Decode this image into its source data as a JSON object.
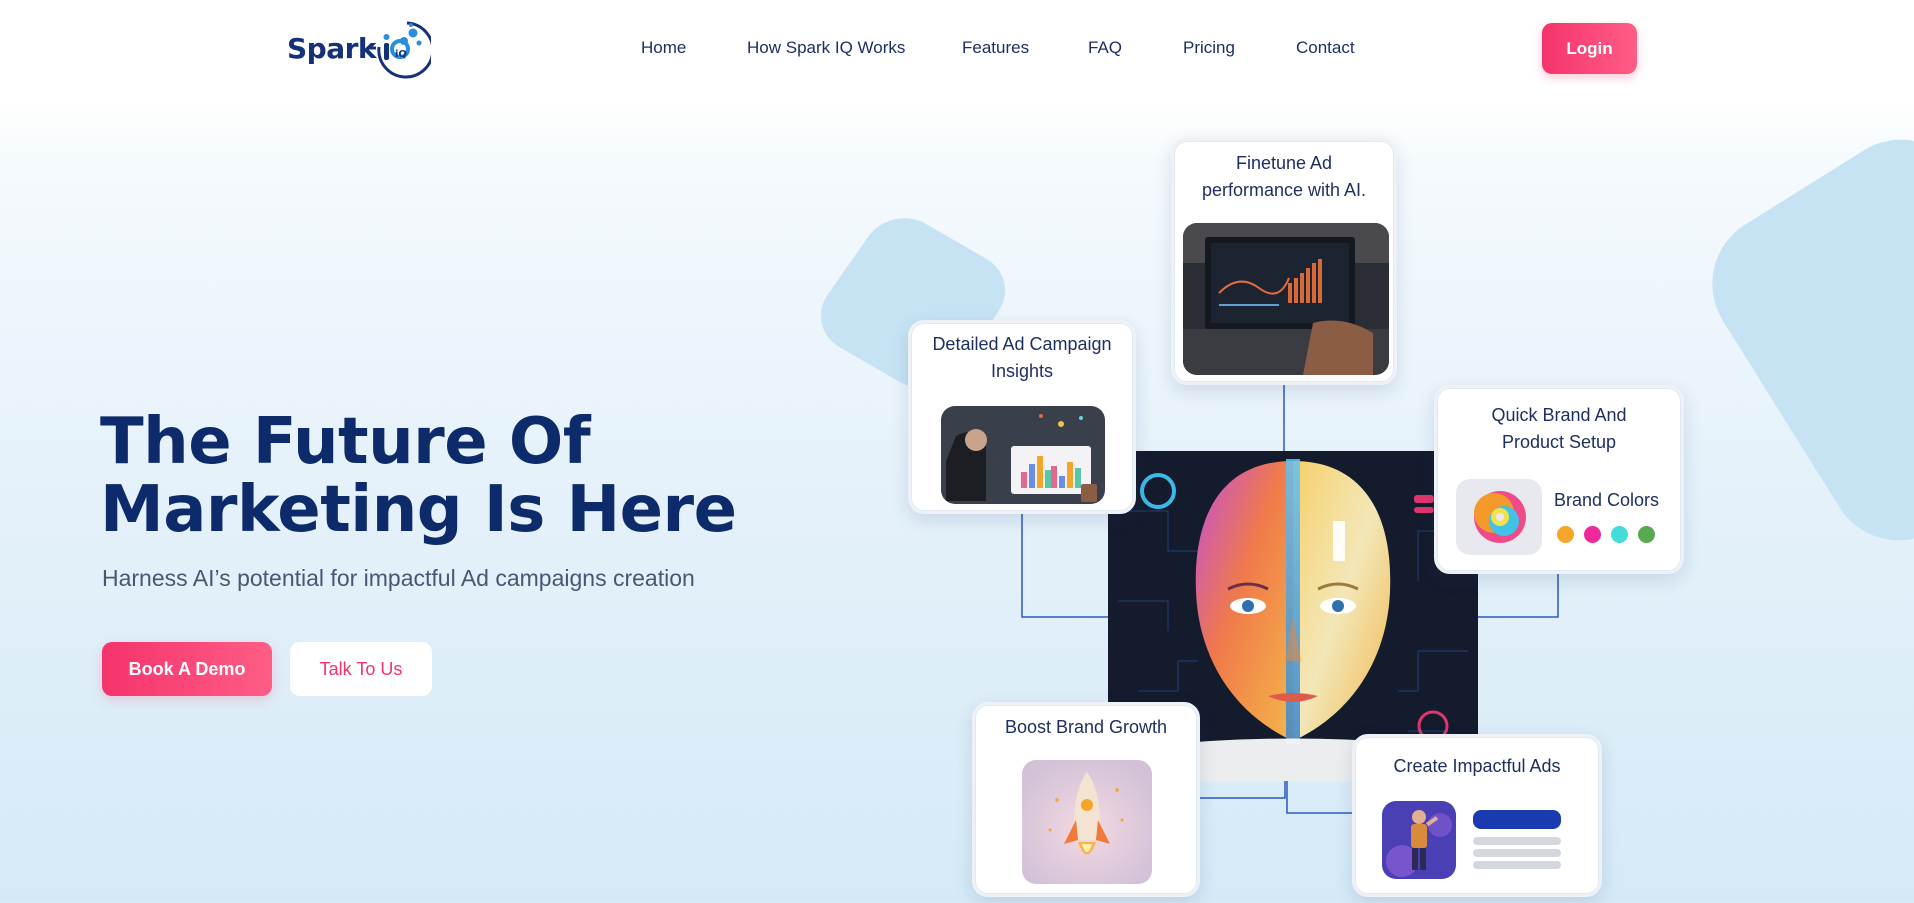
{
  "logo": {
    "text": "Spark",
    "accent_text": "iQ"
  },
  "nav": {
    "items": [
      "Home",
      "How Spark IQ Works",
      "Features",
      "FAQ",
      "Pricing",
      "Contact"
    ],
    "login_label": "Login"
  },
  "hero": {
    "title_line1": "The Future Of",
    "title_line2": "Marketing Is Here",
    "subtitle": "Harness AI’s potential for impactful Ad campaigns creation",
    "primary_button": "Book A Demo",
    "secondary_button": "Talk To Us"
  },
  "cards": {
    "finetune": {
      "title_line1": "Finetune Ad",
      "title_line2": "performance with AI."
    },
    "insights": {
      "title_line1": "Detailed Ad Campaign",
      "title_line2": "Insights"
    },
    "brand_setup": {
      "title_line1": "Quick Brand And",
      "title_line2": "Product Setup",
      "brand_colors_label": "Brand Colors",
      "swatches": [
        "#f4a52a",
        "#f0299a",
        "#44dcd9",
        "#58a94f"
      ]
    },
    "growth": {
      "title": "Boost Brand Growth"
    },
    "create_ads": {
      "title": "Create Impactful Ads"
    }
  },
  "colors": {
    "brand_navy": "#0d2a6b",
    "accent_pink": "#f5336b",
    "connector_blue": "#2b58c4",
    "ad_bar_blue": "#1a3bb0"
  }
}
